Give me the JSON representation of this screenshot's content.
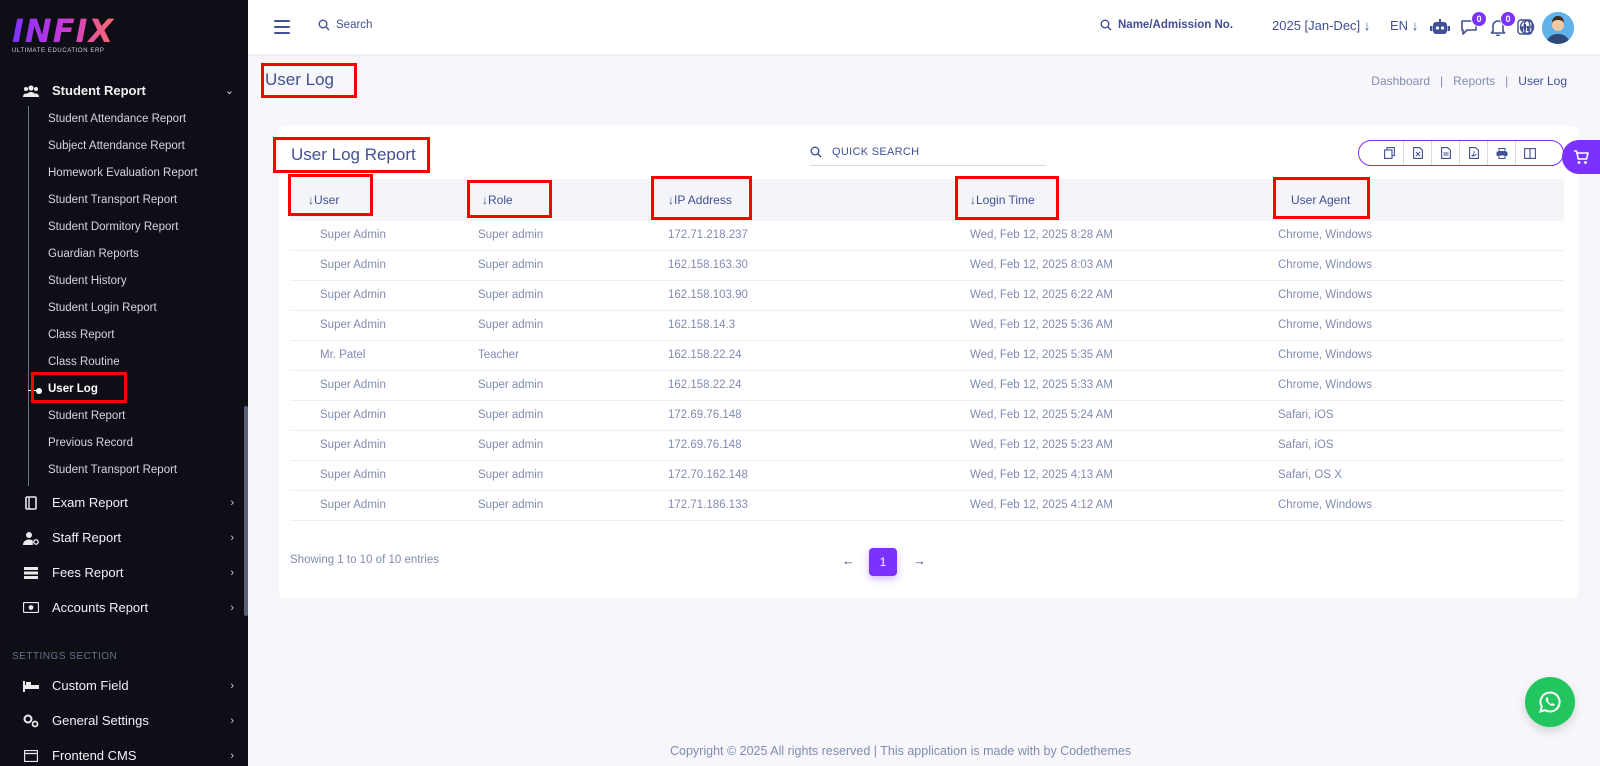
{
  "brand": {
    "logo_text": "INFIX",
    "logo_sub": "ULTIMATE EDUCATION ERP"
  },
  "sidebar": {
    "active_group": "Student Report",
    "student_report_items": [
      "Student Attendance Report",
      "Subject Attendance Report",
      "Homework Evaluation Report",
      "Student Transport Report",
      "Student Dormitory Report",
      "Guardian Reports",
      "Student History",
      "Student Login Report",
      "Class Report",
      "Class Routine",
      "User Log",
      "Student Report",
      "Previous Record",
      "Student Transport Report"
    ],
    "groups": [
      "Exam Report",
      "Staff Report",
      "Fees Report",
      "Accounts Report"
    ],
    "settings_section_title": "SETTINGS SECTION",
    "settings_groups": [
      "Custom Field",
      "General Settings",
      "Frontend CMS"
    ]
  },
  "header": {
    "search_label": "Search",
    "name_search_label": "Name/Admission No.",
    "year": "2025 [Jan-Dec]",
    "language": "EN",
    "chat_badge": "0",
    "notification_badge": "0"
  },
  "page": {
    "title": "User Log",
    "breadcrumb": [
      "Dashboard",
      "Reports",
      "User Log"
    ]
  },
  "report": {
    "title": "User Log Report",
    "quick_search_label": "QUICK SEARCH",
    "columns": [
      "User",
      "Role",
      "IP Address",
      "Login Time",
      "User Agent"
    ],
    "rows": [
      [
        "Super Admin",
        "Super admin",
        "172.71.218.237",
        "Wed, Feb 12, 2025 8:28 AM",
        "Chrome, Windows"
      ],
      [
        "Super Admin",
        "Super admin",
        "162.158.163.30",
        "Wed, Feb 12, 2025 8:03 AM",
        "Chrome, Windows"
      ],
      [
        "Super Admin",
        "Super admin",
        "162.158.103.90",
        "Wed, Feb 12, 2025 6:22 AM",
        "Chrome, Windows"
      ],
      [
        "Super Admin",
        "Super admin",
        "162.158.14.3",
        "Wed, Feb 12, 2025 5:36 AM",
        "Chrome, Windows"
      ],
      [
        "Mr. Patel",
        "Teacher",
        "162.158.22.24",
        "Wed, Feb 12, 2025 5:35 AM",
        "Chrome, Windows"
      ],
      [
        "Super Admin",
        "Super admin",
        "162.158.22.24",
        "Wed, Feb 12, 2025 5:33 AM",
        "Chrome, Windows"
      ],
      [
        "Super Admin",
        "Super admin",
        "172.69.76.148",
        "Wed, Feb 12, 2025 5:24 AM",
        "Safari, iOS"
      ],
      [
        "Super Admin",
        "Super admin",
        "172.69.76.148",
        "Wed, Feb 12, 2025 5:23 AM",
        "Safari, iOS"
      ],
      [
        "Super Admin",
        "Super admin",
        "172.70.162.148",
        "Wed, Feb 12, 2025 4:13 AM",
        "Safari, OS X"
      ],
      [
        "Super Admin",
        "Super admin",
        "172.71.186.133",
        "Wed, Feb 12, 2025 4:12 AM",
        "Chrome, Windows"
      ]
    ],
    "showing_text": "Showing 1 to 10 of 10 entries",
    "current_page": "1",
    "prev_label": "←",
    "next_label": "→"
  },
  "footer": {
    "text": "Copyright © 2025 All rights reserved | This application is made with by Codethemes"
  },
  "colors": {
    "accent": "#7c32ff",
    "primary_text": "#415094",
    "muted_text": "#828bb2",
    "sidebar_bg": "#0e0e17",
    "highlight_box": "#ff0000",
    "whatsapp": "#23c55e"
  },
  "icons": [
    "hamburger-icon",
    "search-icon",
    "chatbot-icon",
    "chat-icon",
    "bell-icon",
    "globe-icon",
    "chart-icon",
    "copy-icon",
    "excel-icon",
    "csv-icon",
    "pdf-icon",
    "print-icon",
    "columns-icon",
    "cart-icon",
    "whatsapp-icon"
  ]
}
